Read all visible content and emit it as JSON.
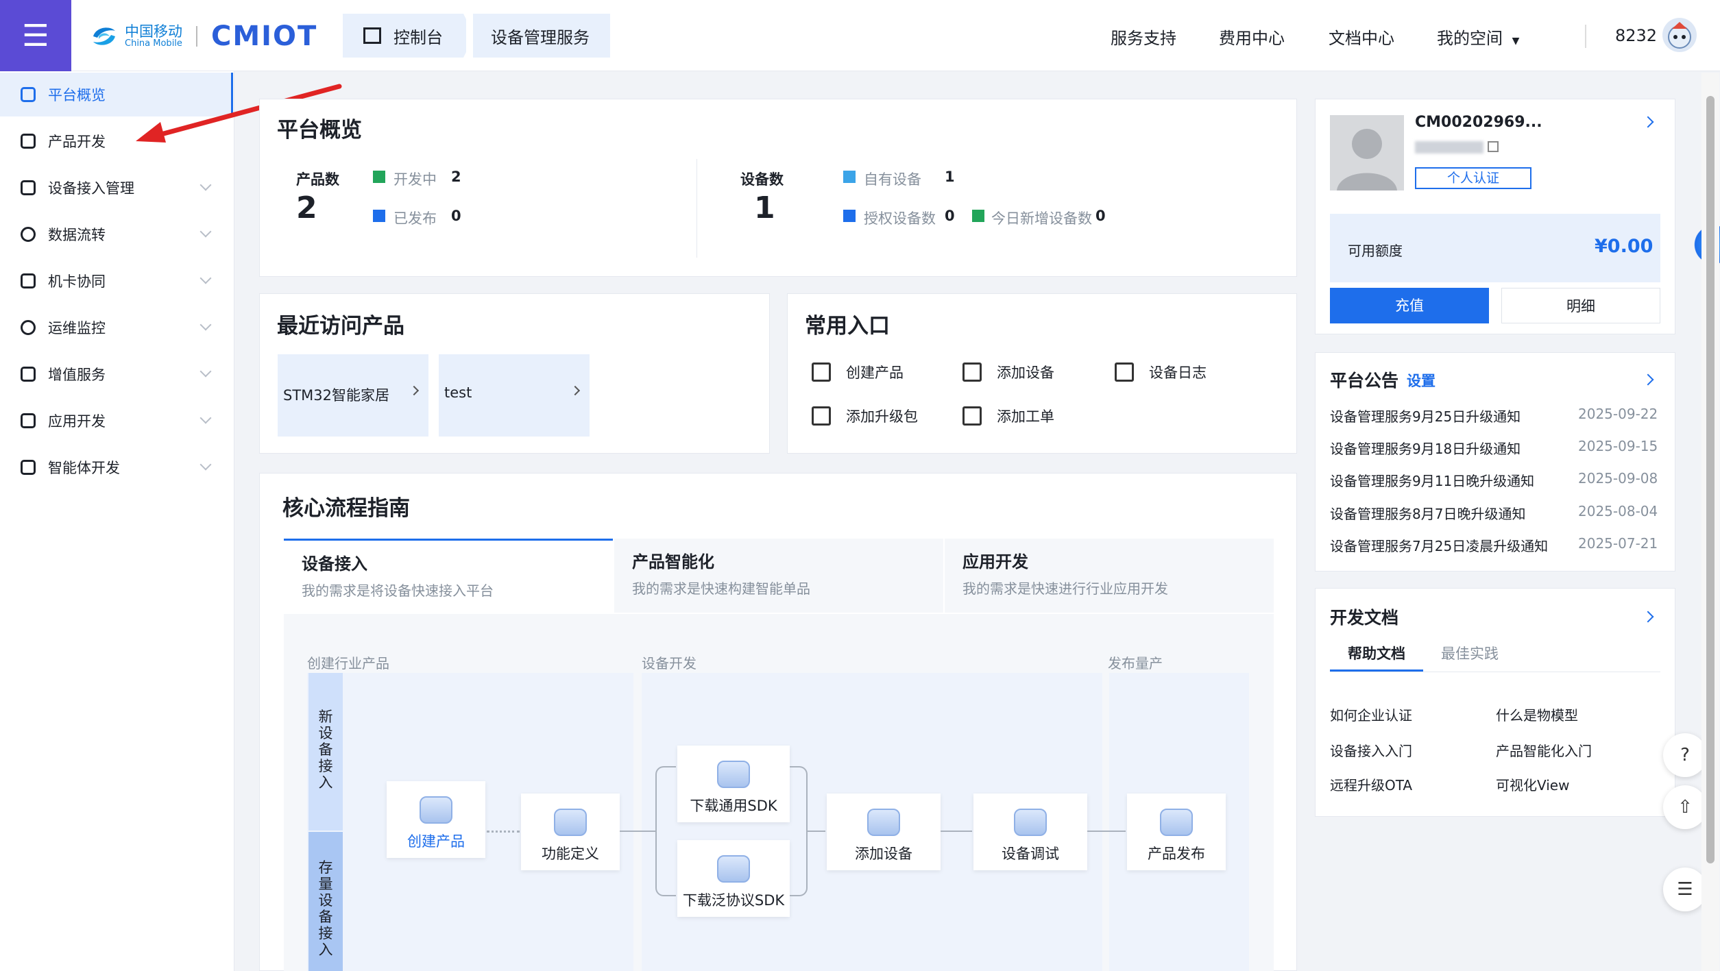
{
  "header": {
    "brand_zh": "中国移动",
    "brand_en": "China Mobile",
    "brand_cmiot": "CMIOT",
    "crumbs": [
      "控制台",
      "设备管理服务"
    ],
    "nav": [
      "服务支持",
      "费用中心",
      "文档中心",
      "我的空间"
    ],
    "user_id": "8232"
  },
  "sidebar": {
    "items": [
      {
        "label": "平台概览"
      },
      {
        "label": "产品开发"
      },
      {
        "label": "设备接入管理"
      },
      {
        "label": "数据流转"
      },
      {
        "label": "机卡协同"
      },
      {
        "label": "运维监控"
      },
      {
        "label": "增值服务"
      },
      {
        "label": "应用开发"
      },
      {
        "label": "智能体开发"
      }
    ]
  },
  "overview": {
    "title": "平台概览",
    "product_label": "产品数",
    "product_count": "2",
    "developing_label": "开发中",
    "developing_count": "2",
    "published_label": "已发布",
    "published_count": "0",
    "device_label": "设备数",
    "device_count": "1",
    "own_label": "自有设备",
    "own_count": "1",
    "auth_label": "授权设备数",
    "auth_count": "0",
    "today_label": "今日新增设备数",
    "today_count": "0"
  },
  "recent": {
    "title": "最近访问产品",
    "items": [
      "STM32智能家居",
      "test"
    ]
  },
  "entries": {
    "title": "常用入口",
    "items": [
      "创建产品",
      "添加设备",
      "设备日志",
      "添加升级包",
      "添加工单"
    ]
  },
  "guide": {
    "title": "核心流程指南",
    "tabs": [
      {
        "title": "设备接入",
        "sub": "我的需求是将设备快速接入平台"
      },
      {
        "title": "产品智能化",
        "sub": "我的需求是快速构建智能单品"
      },
      {
        "title": "应用开发",
        "sub": "我的需求是快速进行行业应用开发"
      }
    ],
    "stages": [
      "创建行业产品",
      "设备开发",
      "发布量产"
    ],
    "lane1": "新设备接入",
    "lane2": "存量设备接入",
    "nodes": [
      "创建产品",
      "功能定义",
      "下载通用SDK",
      "下载泛协议SDK",
      "添加设备",
      "设备调试",
      "产品发布"
    ]
  },
  "account": {
    "name": "CM00202969...",
    "verify": "个人认证",
    "balance_label": "可用额度",
    "balance": "¥0.00",
    "recharge": "充值",
    "detail": "明细"
  },
  "notices": {
    "title": "平台公告",
    "settings": "设置",
    "items": [
      {
        "text": "设备管理服务9月25日升级通知",
        "date": "2025-09-22"
      },
      {
        "text": "设备管理服务9月18日升级通知",
        "date": "2025-09-15"
      },
      {
        "text": "设备管理服务9月11日晚升级通知",
        "date": "2025-09-08"
      },
      {
        "text": "设备管理服务8月7日晚升级通知",
        "date": "2025-08-04"
      },
      {
        "text": "设备管理服务7月25日凌晨升级通知",
        "date": "2025-07-21"
      }
    ]
  },
  "docs": {
    "title": "开发文档",
    "tabs": [
      "帮助文档",
      "最佳实践"
    ],
    "items": [
      "如何企业认证",
      "什么是物模型",
      "设备接入入门",
      "产品智能化入门",
      "远程升级OTA",
      "可视化View"
    ]
  },
  "colors": {
    "accent": "#1e6eeb",
    "sidebar_header": "#5b4bd5",
    "arrow": "#e02424"
  }
}
